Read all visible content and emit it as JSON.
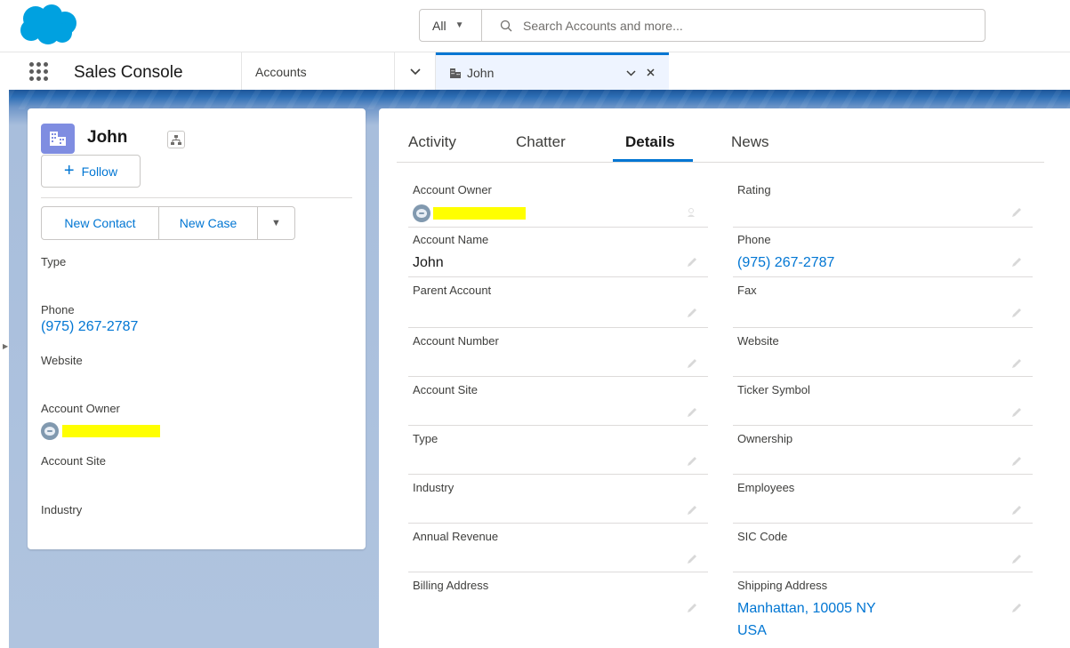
{
  "search": {
    "scope_label": "All",
    "placeholder": "Search Accounts and more..."
  },
  "nav": {
    "app_name": "Sales Console",
    "accounts_tab": "Accounts",
    "record_tab": "John"
  },
  "record": {
    "name": "John",
    "follow_label": "Follow",
    "actions": [
      "New Contact",
      "New Case"
    ]
  },
  "highlights": {
    "type_label": "Type",
    "phone_label": "Phone",
    "phone_value": "(975) 267-2787",
    "website_label": "Website",
    "owner_label": "Account Owner",
    "site_label": "Account Site",
    "industry_label": "Industry"
  },
  "tabs": [
    "Activity",
    "Chatter",
    "Details",
    "News"
  ],
  "active_tab": "Details",
  "details": {
    "left": [
      {
        "label": "Account Owner",
        "value": ""
      },
      {
        "label": "Account Name",
        "value": "John"
      },
      {
        "label": "Parent Account",
        "value": ""
      },
      {
        "label": "Account Number",
        "value": ""
      },
      {
        "label": "Account Site",
        "value": ""
      },
      {
        "label": "Type",
        "value": ""
      },
      {
        "label": "Industry",
        "value": ""
      },
      {
        "label": "Annual Revenue",
        "value": ""
      },
      {
        "label": "Billing Address",
        "value": ""
      }
    ],
    "right": [
      {
        "label": "Rating",
        "value": ""
      },
      {
        "label": "Phone",
        "value": "(975) 267-2787"
      },
      {
        "label": "Fax",
        "value": ""
      },
      {
        "label": "Website",
        "value": ""
      },
      {
        "label": "Ticker Symbol",
        "value": ""
      },
      {
        "label": "Ownership",
        "value": ""
      },
      {
        "label": "Employees",
        "value": ""
      },
      {
        "label": "SIC Code",
        "value": ""
      },
      {
        "label": "Shipping Address",
        "value_line1": "Manhattan, 10005 NY",
        "value_line2": "USA"
      }
    ]
  },
  "colors": {
    "brand": "#00a1e0",
    "link": "#0176d3",
    "account_icon": "#7f8de1",
    "redaction": "#ffff00"
  },
  "icons": [
    "salesforce-cloud-logo",
    "search-icon",
    "app-launcher-icon",
    "account-building-icon",
    "hierarchy-icon",
    "pencil-icon",
    "lock-icon",
    "user-avatar-icon"
  ]
}
